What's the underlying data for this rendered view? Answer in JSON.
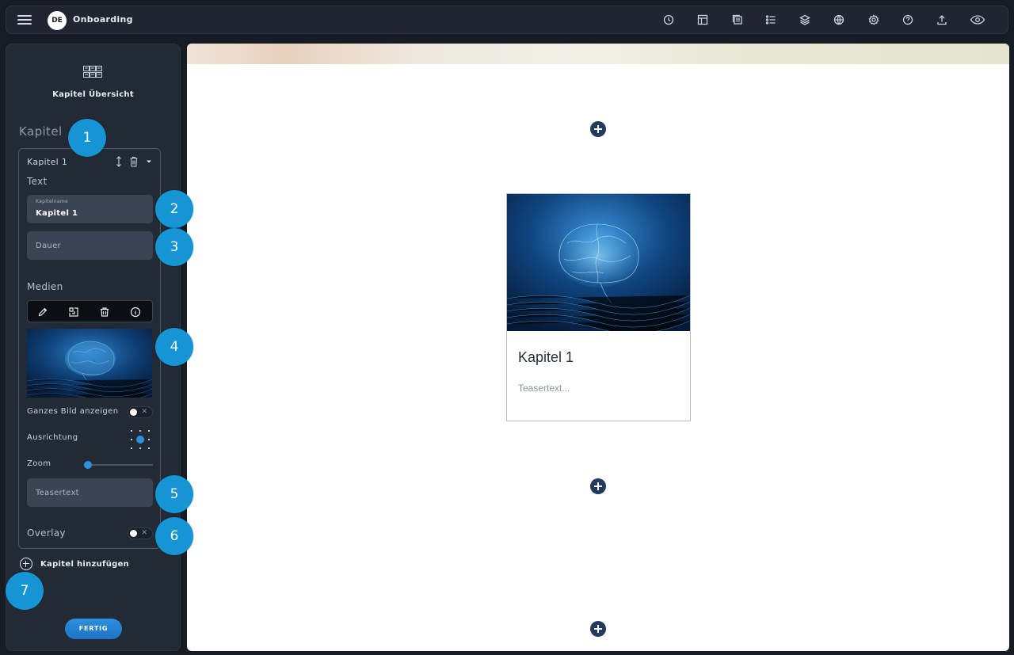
{
  "header": {
    "language": "DE",
    "title": "Onboarding",
    "icons": [
      "history-icon",
      "layout-icon",
      "layers-stack-icon",
      "list-icon",
      "stack-icon",
      "globe-icon",
      "settings-icon",
      "help-icon",
      "upload-icon",
      "preview-eye-icon"
    ]
  },
  "sidebar": {
    "overview_label": "Kapitel Übersicht",
    "heading": "Kapitel",
    "chapter": {
      "title": "Kapitel 1",
      "text_section": "Text",
      "name_field": {
        "label": "Kapitelname",
        "value": "Kapitel 1"
      },
      "duration_field": {
        "placeholder": "Dauer"
      },
      "media_section": "Medien",
      "show_full_image": {
        "label": "Ganzes Bild anzeigen",
        "on": false,
        "off_symbol": "✕"
      },
      "alignment": {
        "label": "Ausrichtung",
        "selected": "center"
      },
      "zoom": {
        "label": "Zoom",
        "value": 0
      },
      "teaser_field": {
        "placeholder": "Teasertext"
      },
      "overlay": {
        "label": "Overlay",
        "on": false,
        "off_symbol": "✕"
      }
    },
    "add_chapter": "Kapitel hinzufügen",
    "done": "FERTIG"
  },
  "markers": [
    "1",
    "2",
    "3",
    "4",
    "5",
    "6",
    "7"
  ],
  "canvas": {
    "card": {
      "title": "Kapitel 1",
      "teaser": "Teasertext..."
    }
  },
  "colors": {
    "accent": "#1595d3",
    "button": "#2a8fe0",
    "add_section": "#233a5e"
  }
}
